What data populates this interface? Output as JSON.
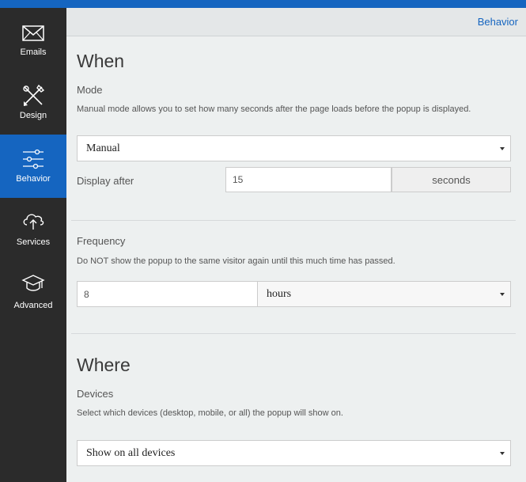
{
  "sidebar": {
    "items": [
      {
        "label": "Emails",
        "icon": "envelope-icon"
      },
      {
        "label": "Design",
        "icon": "brush-icon"
      },
      {
        "label": "Behavior",
        "icon": "sliders-icon",
        "active": true
      },
      {
        "label": "Services",
        "icon": "cloud-upload-icon"
      },
      {
        "label": "Advanced",
        "icon": "graduation-cap-icon"
      }
    ]
  },
  "header": {
    "breadcrumb": "Behavior"
  },
  "when": {
    "heading": "When",
    "mode": {
      "label": "Mode",
      "description": "Manual mode allows you to set how many seconds after the page loads before the popup is displayed.",
      "selected": "Manual"
    },
    "display_after": {
      "label": "Display after",
      "value": "15",
      "unit": "seconds"
    },
    "frequency": {
      "label": "Frequency",
      "description": "Do NOT show the popup to the same visitor again until this much time has passed.",
      "value": "8",
      "unit_selected": "hours"
    }
  },
  "where": {
    "heading": "Where",
    "devices": {
      "label": "Devices",
      "description": "Select which devices (desktop, mobile, or all) the popup will show on.",
      "selected": "Show on all devices"
    }
  },
  "colors": {
    "accent": "#1565c0",
    "sidebar": "#2b2b2b",
    "background": "#edf0f0"
  }
}
